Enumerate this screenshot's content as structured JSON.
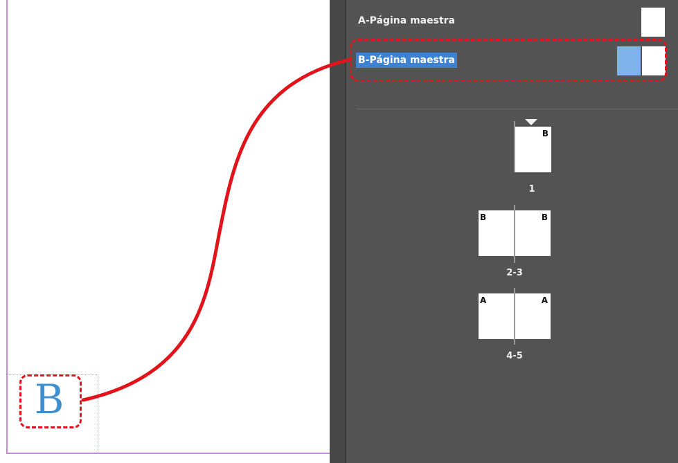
{
  "document": {
    "master_marker": "B"
  },
  "pages_panel": {
    "masters": [
      {
        "label": "A-Página maestra",
        "selected": false
      },
      {
        "label": "B-Página maestra",
        "selected": true
      }
    ],
    "spreads": [
      {
        "number": "1",
        "left_master": "",
        "right_master": "B"
      },
      {
        "number": "2-3",
        "left_master": "B",
        "right_master": "B"
      },
      {
        "number": "4-5",
        "left_master": "A",
        "right_master": "A"
      }
    ]
  },
  "colors": {
    "annotation": "#e0141a",
    "marker": "#3f8fd0",
    "selection": "#3f82d2",
    "panel_background": "#535353"
  }
}
